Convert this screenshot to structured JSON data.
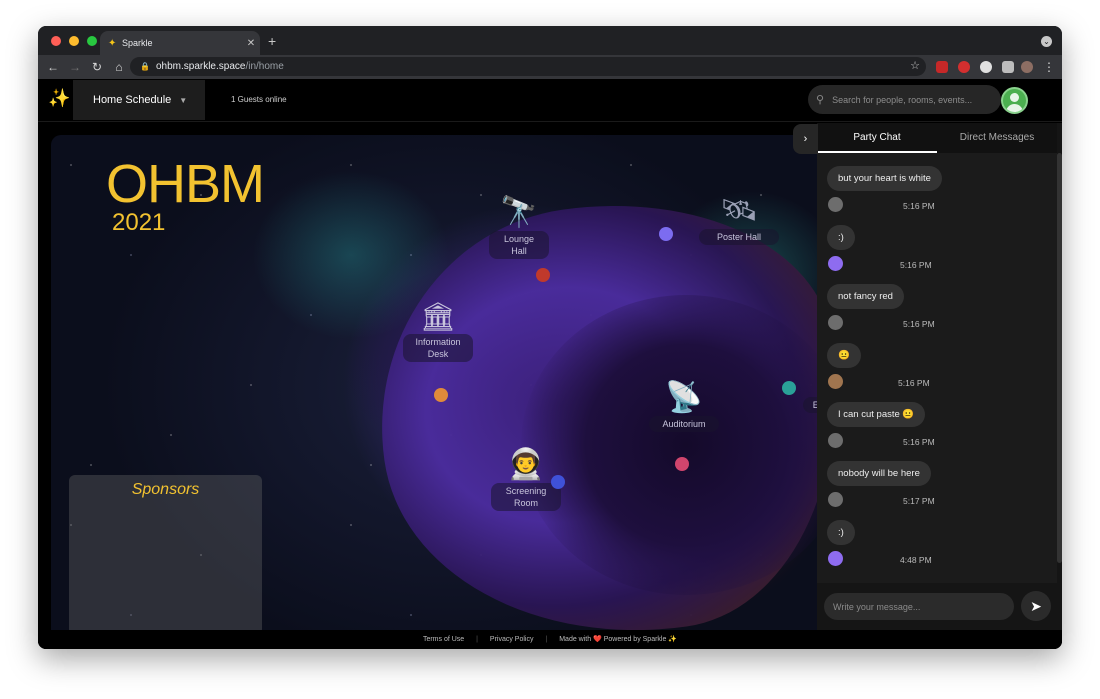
{
  "browser": {
    "tab_title": "Sparkle",
    "url_host": "ohbm.sparkle.space",
    "url_path": "/in/home",
    "icons": {
      "favicon": "sparkle-icon",
      "close_tab": "close-icon",
      "new_tab": "plus-icon",
      "back": "arrow-left-icon",
      "forward": "arrow-right-icon",
      "reload": "reload-icon",
      "home": "home-icon",
      "lock": "lock-icon",
      "bookmark": "star-icon",
      "menu": "kebab-menu-icon"
    },
    "extension_badge": "1"
  },
  "navbar": {
    "schedule_label": "Home Schedule",
    "online_text": "1 Guests online",
    "search_placeholder": "Search for people, rooms, events...",
    "colors": {
      "logo": "#f5c518",
      "avatar": "#4caf50"
    }
  },
  "map": {
    "title": "OHBM",
    "year": "2021",
    "sponsors_title": "Sponsors",
    "venues": [
      {
        "label_line1": "Lounge",
        "label_line2": "Hall"
      },
      {
        "label_line1": "Poster Hall",
        "label_line2": ""
      },
      {
        "label_line1": "Information",
        "label_line2": "Desk"
      },
      {
        "label_line1": "Auditorium",
        "label_line2": ""
      },
      {
        "label_line1": "Screening",
        "label_line2": "Room"
      },
      {
        "label_line1": "Ex",
        "label_line2": ""
      }
    ],
    "colors": {
      "title": "#f2c230"
    }
  },
  "chat": {
    "tabs": [
      {
        "label": "Party Chat",
        "active": true
      },
      {
        "label": "Direct Messages",
        "active": false
      }
    ],
    "messages": [
      {
        "text": "but your heart is white",
        "time": "5:16 PM",
        "avatar": "photo"
      },
      {
        "text": ":)",
        "time": "5:16 PM",
        "avatar": "purple"
      },
      {
        "text": "not fancy red",
        "time": "5:16 PM",
        "avatar": "photo"
      },
      {
        "text": "😐",
        "time": "5:16 PM",
        "avatar": "photo2"
      },
      {
        "text": "I can cut paste 😐",
        "time": "5:16 PM",
        "avatar": "photo"
      },
      {
        "text": "nobody will be here",
        "time": "5:17 PM",
        "avatar": "photo"
      },
      {
        "text": ":)",
        "time": "4:48 PM",
        "avatar": "purple"
      }
    ],
    "input_placeholder": "Write your message...",
    "send_icon": "send-icon"
  },
  "footer": {
    "terms": "Terms of Use",
    "privacy": "Privacy Policy",
    "made_with": "Made with ❤️ Powered by Sparkle ✨"
  }
}
